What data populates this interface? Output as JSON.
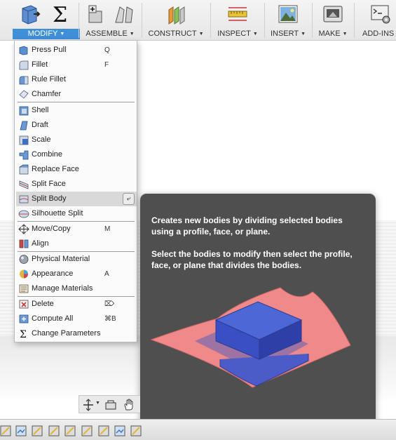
{
  "toolbar": {
    "groups": [
      {
        "label": "MODIFY",
        "icon": "modify-icon"
      },
      {
        "label": "ASSEMBLE",
        "icon": "assemble-icon"
      },
      {
        "label": "CONSTRUCT",
        "icon": "construct-icon"
      },
      {
        "label": "INSPECT",
        "icon": "inspect-icon"
      },
      {
        "label": "INSERT",
        "icon": "insert-icon"
      },
      {
        "label": "MAKE",
        "icon": "make-icon"
      },
      {
        "label": "ADD-INS",
        "icon": "add-ins-icon"
      }
    ],
    "active_group": "MODIFY",
    "accent_color": "#3f8ed8"
  },
  "menu": {
    "items": [
      {
        "label": "Press Pull",
        "shortcut": "Q",
        "icon": "press-pull-icon"
      },
      {
        "label": "Fillet",
        "shortcut": "F",
        "icon": "fillet-icon"
      },
      {
        "label": "Rule Fillet",
        "shortcut": "",
        "icon": "rule-fillet-icon"
      },
      {
        "label": "Chamfer",
        "shortcut": "",
        "icon": "chamfer-icon"
      },
      {
        "label": "Shell",
        "shortcut": "",
        "icon": "shell-icon"
      },
      {
        "label": "Draft",
        "shortcut": "",
        "icon": "draft-icon"
      },
      {
        "label": "Scale",
        "shortcut": "",
        "icon": "scale-icon"
      },
      {
        "label": "Combine",
        "shortcut": "",
        "icon": "combine-icon"
      },
      {
        "label": "Replace Face",
        "shortcut": "",
        "icon": "replace-face-icon"
      },
      {
        "label": "Split Face",
        "shortcut": "",
        "icon": "split-face-icon"
      },
      {
        "label": "Split Body",
        "shortcut": "",
        "icon": "split-body-icon",
        "highlighted": true
      },
      {
        "label": "Silhouette Split",
        "shortcut": "",
        "icon": "silhouette-split-icon"
      },
      {
        "label": "Move/Copy",
        "shortcut": "M",
        "icon": "move-copy-icon"
      },
      {
        "label": "Align",
        "shortcut": "",
        "icon": "align-icon"
      },
      {
        "label": "Physical Material",
        "shortcut": "",
        "icon": "physical-material-icon"
      },
      {
        "label": "Appearance",
        "shortcut": "A",
        "icon": "appearance-icon"
      },
      {
        "label": "Manage Materials",
        "shortcut": "",
        "icon": "manage-materials-icon"
      },
      {
        "label": "Delete",
        "shortcut": "⌦",
        "icon": "delete-icon"
      },
      {
        "label": "Compute All",
        "shortcut": "⌘B",
        "icon": "compute-all-icon"
      },
      {
        "label": "Change Parameters",
        "shortcut": "",
        "icon": "change-parameters-icon"
      }
    ],
    "pin_icon": "pin-icon"
  },
  "tooltip": {
    "description": "Creates new bodies by dividing selected bodies using a profile, face, or plane.",
    "instruction": "Select the bodies to modify then select the profile, face, or plane that divides the bodies.",
    "illustration": "split-body-illustration",
    "colors": {
      "background": "#4f4f4f",
      "plane": "#f08a8a",
      "body": "#3b4fc4"
    }
  },
  "nav_bar": {
    "icons": [
      "orbit-icon",
      "look-at-icon",
      "pan-icon"
    ]
  },
  "timeline": {
    "icon": "timeline-feature-icon"
  }
}
